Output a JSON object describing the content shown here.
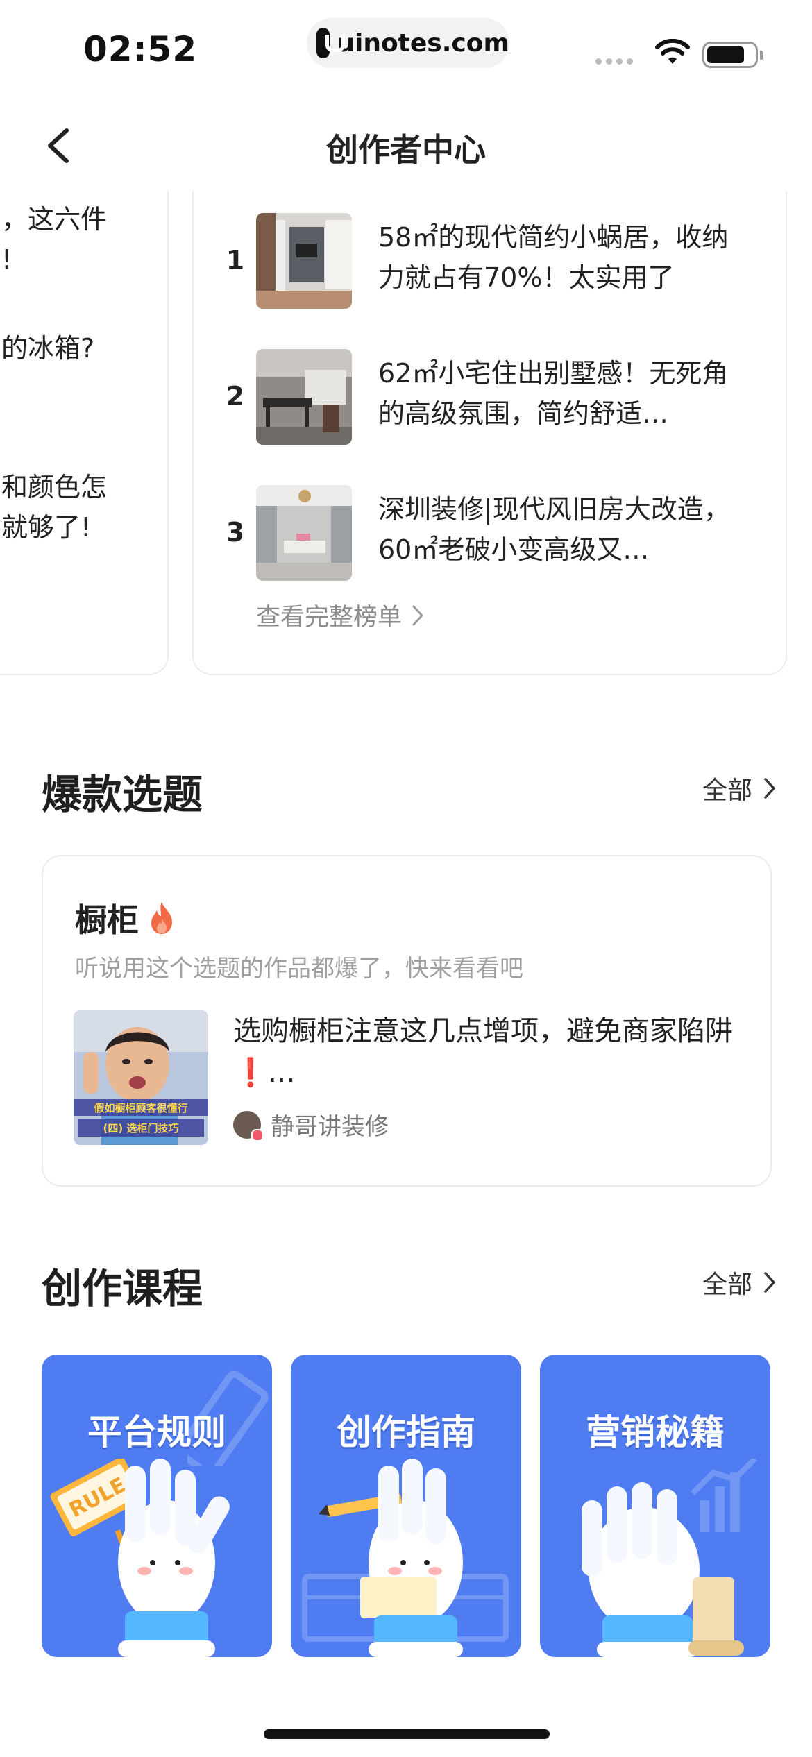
{
  "status_bar": {
    "time": "02:52",
    "url": "uinotes.com"
  },
  "nav": {
    "title": "创作者中心"
  },
  "ranking_prev_card": {
    "lines": [
      "，这六件",
      "!",
      "的冰箱?",
      "和颜色怎",
      "就够了!"
    ]
  },
  "ranking": {
    "items": [
      {
        "rank": "1",
        "title": "58㎡的现代简约小蜗居，收纳力就占有70%！太实用了"
      },
      {
        "rank": "2",
        "title": "62㎡小宅住出别墅感！无死角的高级氛围，简约舒适…"
      },
      {
        "rank": "3",
        "title": "深圳装修|现代风旧房大改造，60㎡老破小变高级又…"
      }
    ],
    "see_full": "查看完整榜单"
  },
  "hot_topics": {
    "title": "爆款选题",
    "all_label": "全部",
    "topic_name": "橱柜",
    "topic_desc": "听说用这个选题的作品都爆了，快来看看吧",
    "post_title": "选购橱柜注意这几点增项，避免商家陷阱❗…",
    "author": "静哥讲装修",
    "thumb_caption_line1": "假如橱柜顾客很懂行",
    "thumb_caption_line2": "(四) 选柜门技巧"
  },
  "courses": {
    "title": "创作课程",
    "all_label": "全部",
    "items": [
      {
        "label": "平台规则",
        "sign_text": "RULE"
      },
      {
        "label": "创作指南"
      },
      {
        "label": "营销秘籍"
      }
    ]
  },
  "colors": {
    "course_blue": "#4f7cf0",
    "hint_gray": "#a0a0a0",
    "flame": "#f26a45"
  }
}
